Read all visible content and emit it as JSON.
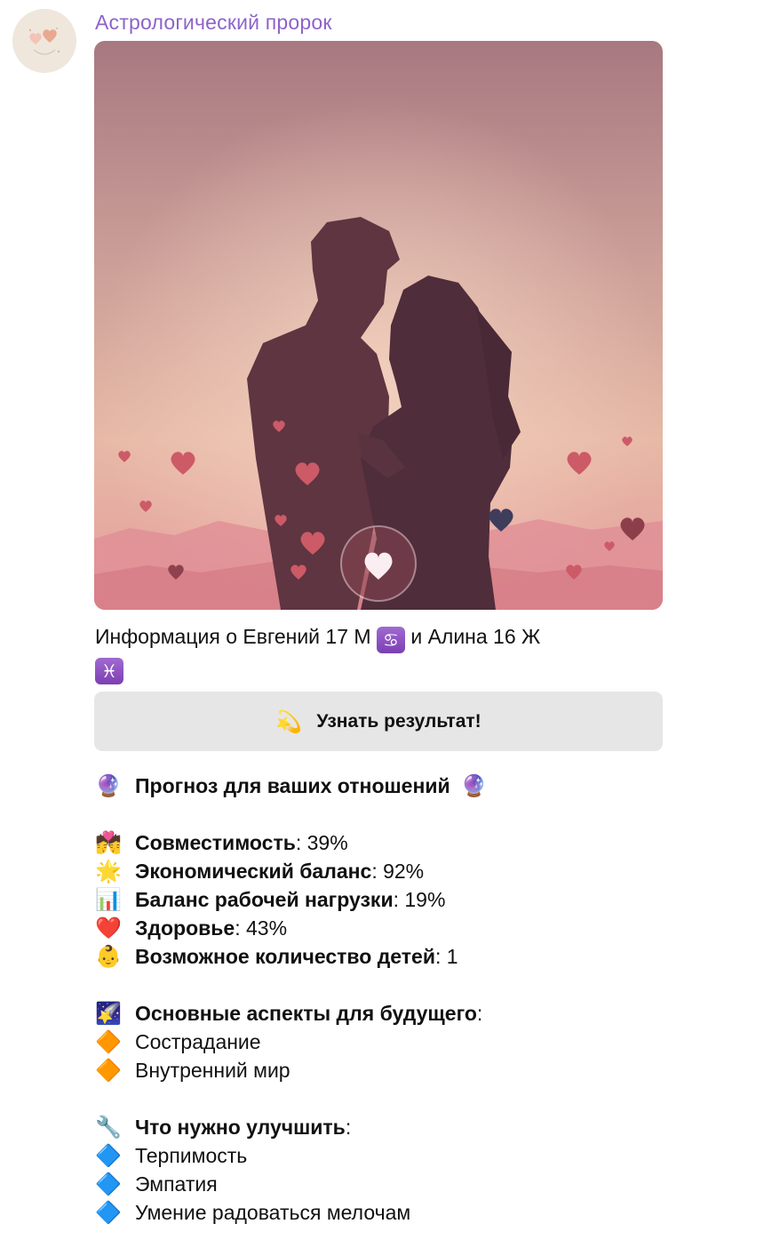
{
  "sender": {
    "name": "Астрологический пророк"
  },
  "post": {
    "info_prefix": "Информация о Евгений 17 М",
    "sign1_icon": "♋",
    "info_middle": "и Алина 16 Ж",
    "sign2_icon": "♓",
    "button": {
      "emoji": "💫",
      "label": "Узнать результат!"
    }
  },
  "forecast": {
    "title_emoji": "🔮",
    "title": "Прогноз для ваших отношений",
    "title_emoji_end": "🔮",
    "stats": [
      {
        "emoji": "💏",
        "label": "Совместимость",
        "value": ": 39%"
      },
      {
        "emoji": "🌟",
        "label": "Экономический баланс",
        "value": ": 92%"
      },
      {
        "emoji": "📊",
        "label": "Баланс рабочей нагрузки",
        "value": ": 19%"
      },
      {
        "emoji": "❤️",
        "label": "Здоровье",
        "value": ": 43%"
      },
      {
        "emoji": "👶",
        "label": "Возможное количество детей",
        "value": ": 1"
      }
    ],
    "aspects": {
      "emoji": "🌠",
      "title": "Основные аспекты для будущего",
      "colon": ":",
      "items": [
        {
          "emoji": "🔶",
          "text": "Сострадание"
        },
        {
          "emoji": "🔶",
          "text": "Внутренний мир"
        }
      ]
    },
    "improve": {
      "emoji": "🔧",
      "title": "Что нужно улучшить",
      "colon": ":",
      "items": [
        {
          "emoji": "🔷",
          "text": "Терпимость"
        },
        {
          "emoji": "🔷",
          "text": "Эмпатия"
        },
        {
          "emoji": "🔷",
          "text": "Умение радоваться мелочам"
        }
      ]
    }
  }
}
